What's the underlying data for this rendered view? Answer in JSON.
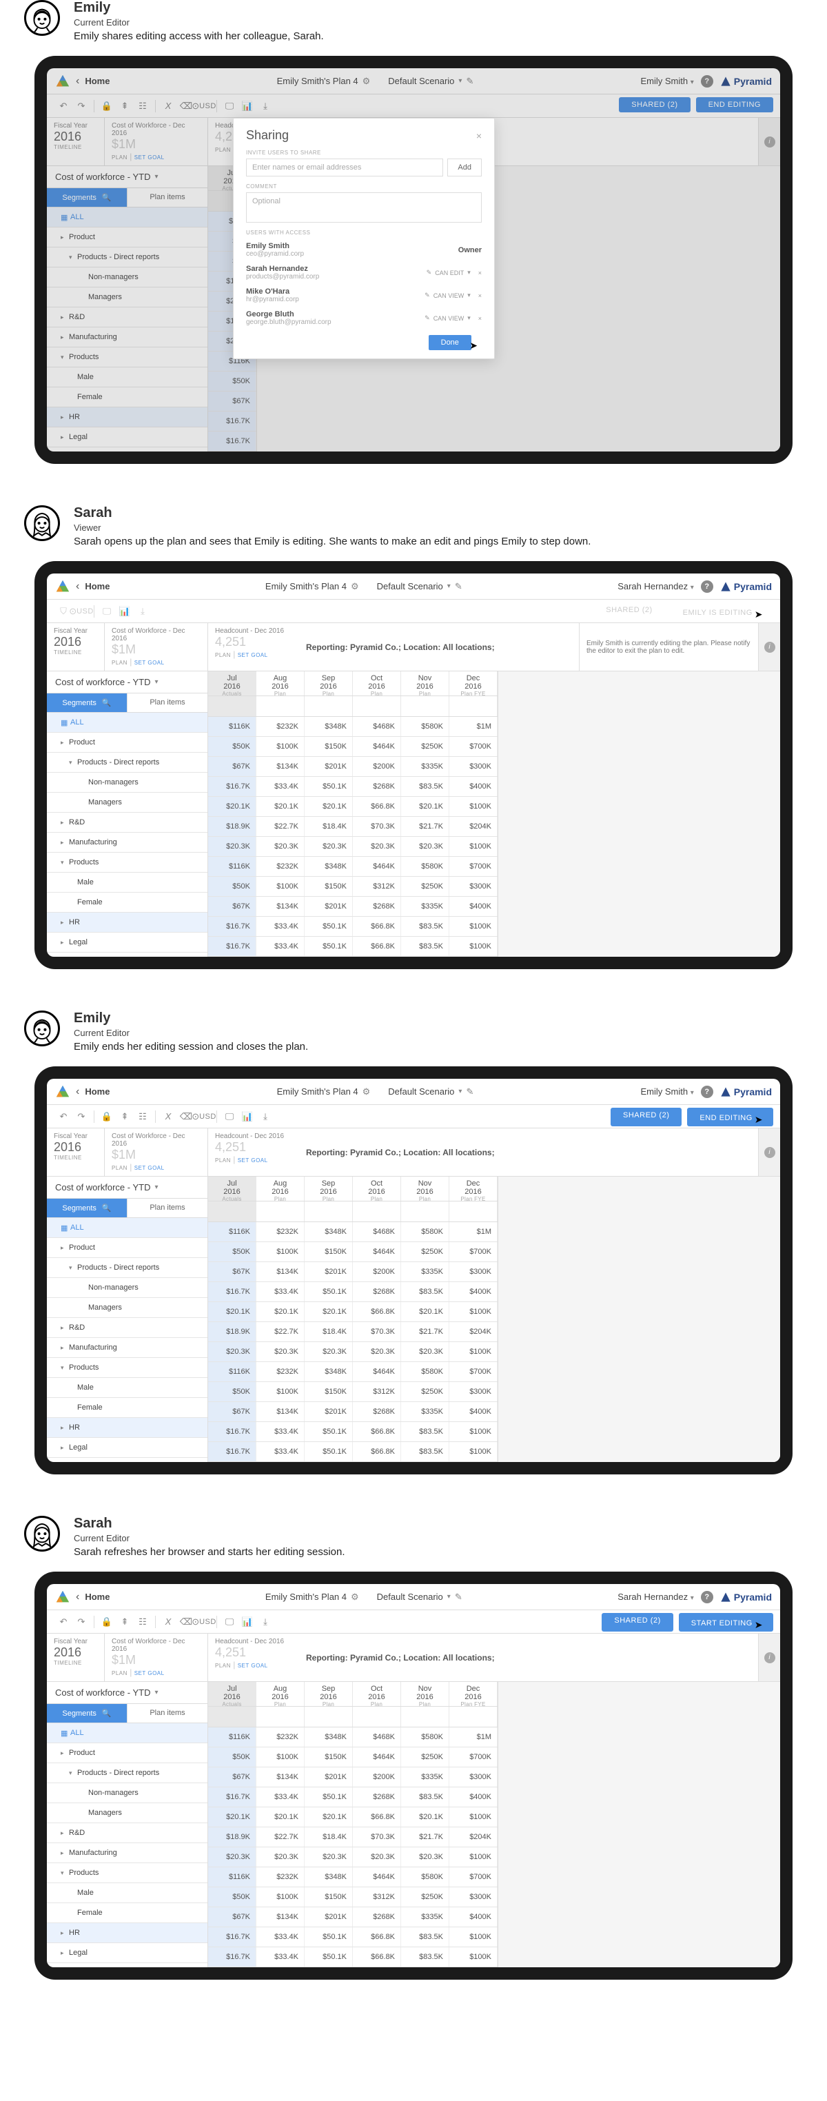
{
  "steps": [
    {
      "name": "Emily",
      "role": "Current Editor",
      "desc": "Emily shares editing access with her colleague, Sarah.",
      "user": "Emily Smith",
      "btn1_label": "SHARED (2)",
      "btn2_label": "END EDITING",
      "btn1_cls": "btn-blue",
      "btn2_cls": "btn-blue",
      "sharing": true,
      "toolbar_full": true,
      "notice": null
    },
    {
      "name": "Sarah",
      "role": "Viewer",
      "desc": "Sarah opens up the plan and sees that Emily is editing. She wants to make an edit and pings Emily to step down.",
      "user": "Sarah Hernandez",
      "btn1_label": "SHARED (2)",
      "btn2_label": "EMILY IS EDITING",
      "btn1_cls": "btn-ghost",
      "btn2_cls": "btn-ghost",
      "sharing": false,
      "toolbar_full": false,
      "notice": "Emily Smith is currently editing the plan. Please notify the editor to exit the plan to edit."
    },
    {
      "name": "Emily",
      "role": "Current Editor",
      "desc": "Emily ends her editing session and closes the plan.",
      "user": "Emily Smith",
      "btn1_label": "SHARED (2)",
      "btn2_label": "END EDITING",
      "btn1_cls": "btn-blue",
      "btn2_cls": "btn-blue",
      "sharing": false,
      "toolbar_full": true,
      "notice": null
    },
    {
      "name": "Sarah",
      "role": "Current Editor",
      "desc": "Sarah refreshes her browser and starts her editing session.",
      "user": "Sarah Hernandez",
      "btn1_label": "SHARED (2)",
      "btn2_label": "START EDITING",
      "btn1_cls": "btn-blue",
      "btn2_cls": "btn-blue",
      "sharing": false,
      "toolbar_full": true,
      "notice": null
    }
  ],
  "topbar": {
    "home": "Home",
    "plan": "Emily Smith's Plan 4",
    "scenario": "Default Scenario",
    "product": "Pyramid"
  },
  "subbar": {
    "fiscal_label": "Fiscal Year",
    "year": "2016",
    "timeline": "TIMELINE",
    "cow_label": "Cost of Workforce - Dec 2016",
    "cow_value": "$1M",
    "plan": "PLAN",
    "setgoal": "SET GOAL",
    "hc_label": "Headcount - Dec 2016",
    "hc_value": "4,251",
    "report": "Reporting: Pyramid Co.; Location: All locations;",
    "report_short": "Repor"
  },
  "metric": "Cost of workforce - YTD",
  "tabs": {
    "segments": "Segments",
    "plan_items": "Plan items"
  },
  "tree": [
    {
      "label": "ALL",
      "cls": "all",
      "icon": "grid",
      "caret": ""
    },
    {
      "label": "Product",
      "cls": "tree-indent-1",
      "caret": "▸"
    },
    {
      "label": "Products - Direct reports",
      "cls": "tree-indent-2",
      "caret": "▾"
    },
    {
      "label": "Non-managers",
      "cls": "tree-indent-3",
      "caret": ""
    },
    {
      "label": "Managers",
      "cls": "tree-indent-3",
      "caret": ""
    },
    {
      "label": "R&D",
      "cls": "tree-indent-1",
      "caret": "▸"
    },
    {
      "label": "Manufacturing",
      "cls": "tree-indent-1",
      "caret": "▸"
    },
    {
      "label": "Products",
      "cls": "tree-indent-1",
      "caret": "▾"
    },
    {
      "label": "Male",
      "cls": "tree-indent-2",
      "caret": ""
    },
    {
      "label": "Female",
      "cls": "tree-indent-2",
      "caret": ""
    },
    {
      "label": "HR",
      "cls": "tree-indent-1 highlight",
      "caret": "▸"
    },
    {
      "label": "Legal",
      "cls": "tree-indent-1",
      "caret": "▸"
    }
  ],
  "periods": [
    {
      "m": "Jul",
      "y": "2016",
      "sub": "Actuals",
      "first": true
    },
    {
      "m": "Aug",
      "y": "2016",
      "sub": "Plan"
    },
    {
      "m": "Sep",
      "y": "2016",
      "sub": "Plan"
    },
    {
      "m": "Oct",
      "y": "2016",
      "sub": "Plan"
    },
    {
      "m": "Nov",
      "y": "2016",
      "sub": "Plan"
    },
    {
      "m": "Dec",
      "y": "2016",
      "sub": "Plan FYE"
    }
  ],
  "grid": [
    [
      "$116K",
      "$232K",
      "$348K",
      "$468K",
      "$580K",
      "$1M"
    ],
    [
      "$50K",
      "$100K",
      "$150K",
      "$464K",
      "$250K",
      "$700K"
    ],
    [
      "$67K",
      "$134K",
      "$201K",
      "$200K",
      "$335K",
      "$300K"
    ],
    [
      "$16.7K",
      "$33.4K",
      "$50.1K",
      "$268K",
      "$83.5K",
      "$400K"
    ],
    [
      "$20.1K",
      "$20.1K",
      "$20.1K",
      "$66.8K",
      "$20.1K",
      "$100K"
    ],
    [
      "$18.9K",
      "$22.7K",
      "$18.4K",
      "$70.3K",
      "$21.7K",
      "$204K"
    ],
    [
      "$20.3K",
      "$20.3K",
      "$20.3K",
      "$20.3K",
      "$20.3K",
      "$100K"
    ],
    [
      "$116K",
      "$232K",
      "$348K",
      "$464K",
      "$580K",
      "$700K"
    ],
    [
      "$50K",
      "$100K",
      "$150K",
      "$312K",
      "$250K",
      "$300K"
    ],
    [
      "$67K",
      "$134K",
      "$201K",
      "$268K",
      "$335K",
      "$400K"
    ],
    [
      "$16.7K",
      "$33.4K",
      "$50.1K",
      "$66.8K",
      "$83.5K",
      "$100K"
    ],
    [
      "$16.7K",
      "$33.4K",
      "$50.1K",
      "$66.8K",
      "$83.5K",
      "$100K"
    ]
  ],
  "sharing": {
    "title": "Sharing",
    "invite_label": "INVITE USERS TO SHARE",
    "input_placeholder": "Enter names or email addresses",
    "add": "Add",
    "comment_label": "COMMENT",
    "comment_placeholder": "Optional",
    "access_label": "USERS WITH ACCESS",
    "users": [
      {
        "name": "Emily Smith",
        "email": "ceo@pyramid.corp",
        "role": "Owner",
        "owner": true
      },
      {
        "name": "Sarah Hernandez",
        "email": "products@pyramid.corp",
        "role": "CAN EDIT"
      },
      {
        "name": "Mike O'Hara",
        "email": "hr@pyramid.corp",
        "role": "CAN VIEW"
      },
      {
        "name": "George Bluth",
        "email": "george.bluth@pyramid.corp",
        "role": "CAN VIEW"
      }
    ],
    "done": "Done"
  }
}
